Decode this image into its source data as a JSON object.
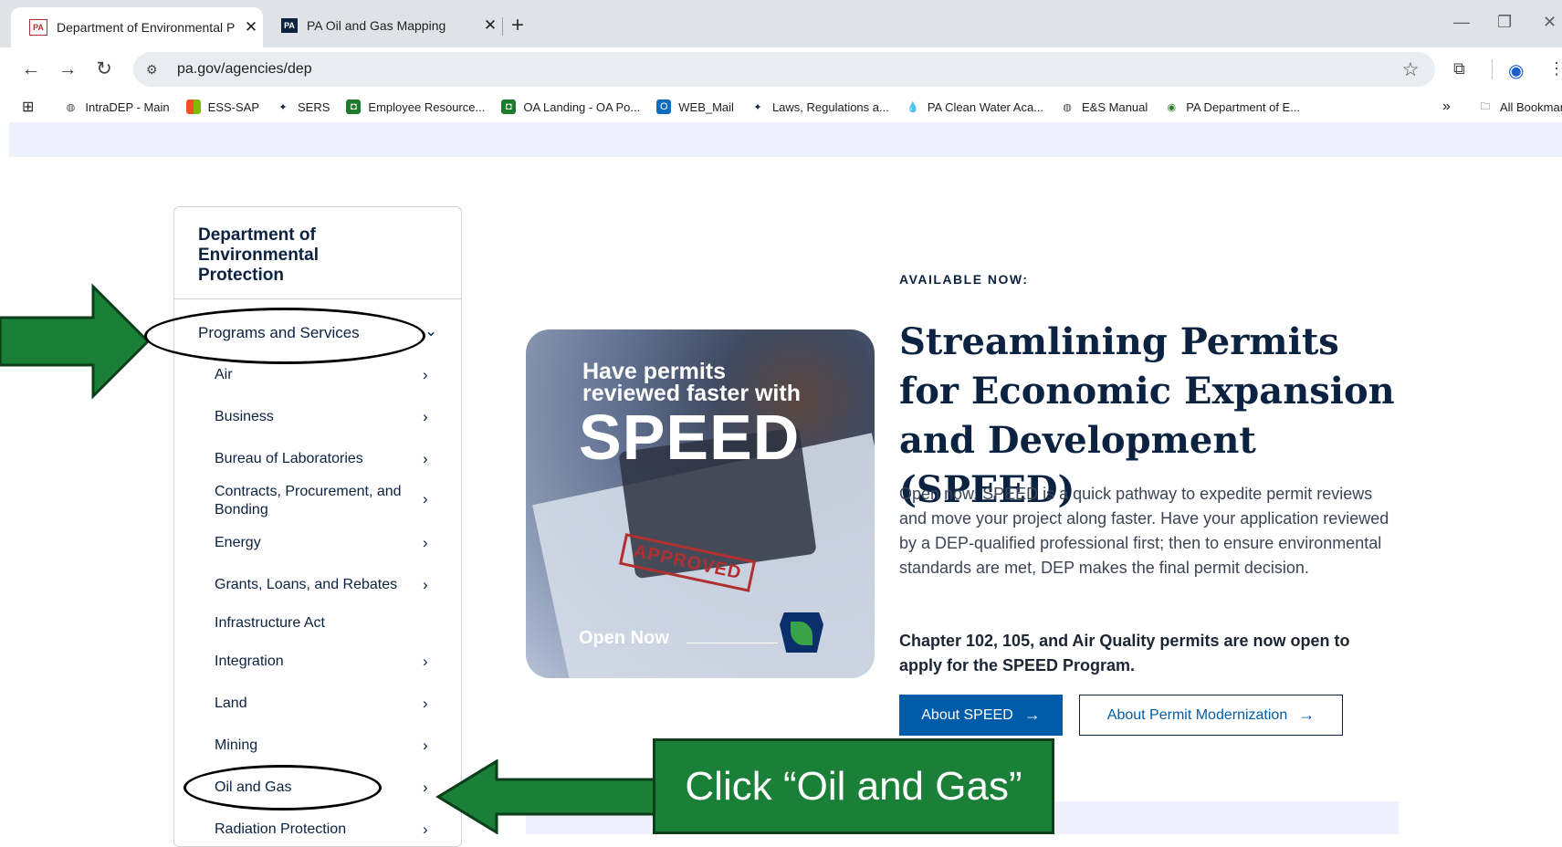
{
  "tabs": [
    {
      "title": "Department of Environmental P",
      "favicon": "PA",
      "close": "✕"
    },
    {
      "title": "PA Oil and Gas Mapping",
      "favicon": "PA",
      "close": "✕"
    }
  ],
  "address_bar": {
    "url": "pa.gov/agencies/dep"
  },
  "bookmarks": [
    {
      "label": "IntraDEP - Main",
      "icon": "globe-icon"
    },
    {
      "label": "ESS-SAP",
      "icon": "windows-icon"
    },
    {
      "label": "SERS",
      "icon": "pa-seal-icon"
    },
    {
      "label": "Employee Resource...",
      "icon": "green-square-icon"
    },
    {
      "label": "OA Landing - OA Po...",
      "icon": "green-square-icon"
    },
    {
      "label": "WEB_Mail",
      "icon": "outlook-icon"
    },
    {
      "label": "Laws, Regulations a...",
      "icon": "pa-seal-icon"
    },
    {
      "label": "PA Clean Water Aca...",
      "icon": "water-drop-icon"
    },
    {
      "label": "E&S Manual",
      "icon": "globe-icon"
    },
    {
      "label": "PA Department of E...",
      "icon": "earth-icon"
    }
  ],
  "bookmarks_overflow": "»",
  "all_bookmarks": "All Bookmarks",
  "sidenav": {
    "department": "Department of Environmental Protection",
    "section": "Programs and Services",
    "items": [
      {
        "label": "Air"
      },
      {
        "label": "Business"
      },
      {
        "label": "Bureau of Laboratories"
      },
      {
        "label": "Contracts, Procurement, and Bonding"
      },
      {
        "label": "Energy"
      },
      {
        "label": "Grants, Loans, and Rebates"
      },
      {
        "label": "Infrastructure Act"
      },
      {
        "label": "Integration"
      },
      {
        "label": "Land"
      },
      {
        "label": "Mining"
      },
      {
        "label": "Oil and Gas"
      },
      {
        "label": "Radiation Protection"
      }
    ]
  },
  "feature": {
    "eyebrow": "AVAILABLE NOW:",
    "headline": "Streamlining Permits for Economic Expansion and Development (SPEED)",
    "description": "Open now, SPEED is a quick pathway to expedite permit reviews and move your project along faster. Have your application reviewed by a DEP-qualified professional first; then to ensure environmental standards are met, DEP makes the final permit decision.",
    "note": "Chapter 102, 105, and Air Quality permits are now open to apply for the SPEED Program.",
    "primary_button": "About SPEED",
    "secondary_button": "About Permit Modernization",
    "arrow": "→"
  },
  "hero_image": {
    "line1": "Have permits reviewed faster with",
    "big": "SPEED",
    "stamp": "APPROVED",
    "cta": "Open Now"
  },
  "annotation": {
    "callout": "Click “Oil and Gas”",
    "color": "#1a7f37"
  }
}
